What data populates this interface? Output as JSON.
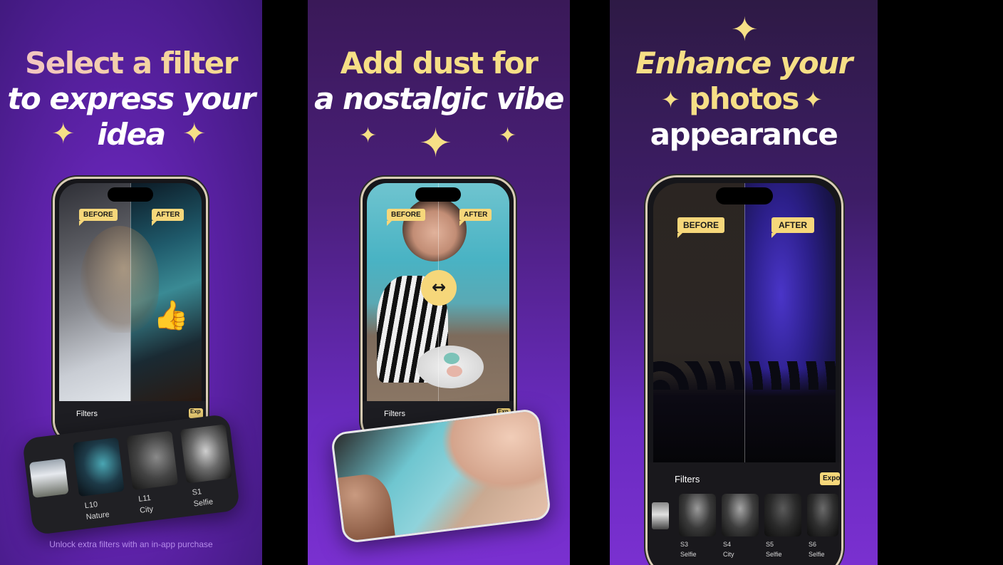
{
  "panel1": {
    "headline": [
      "Select a filter",
      "to express your",
      "idea"
    ],
    "tag_before": "BEFORE",
    "tag_after": "AFTER",
    "bar_label": "Filters",
    "bar_export": "Exp",
    "filters": [
      {
        "code": "",
        "name": ""
      },
      {
        "code": "L10",
        "name": "Nature"
      },
      {
        "code": "L11",
        "name": "City"
      },
      {
        "code": "S1",
        "name": "Selfie"
      }
    ],
    "caption": "Unlock extra filters with an in-app purchase",
    "thumb_icon": "thumbs-up"
  },
  "panel2": {
    "headline": [
      "Add dust for",
      "a nostalgic vibe"
    ],
    "tag_before": "BEFORE",
    "tag_after": "AFTER",
    "bar_label": "Filters",
    "bar_export": "Exp",
    "slider_icon": "↔"
  },
  "panel3": {
    "headline": [
      "Enhance your",
      "photos",
      "appearance"
    ],
    "tag_before": "BEFORE",
    "tag_after": "AFTER",
    "bar_label": "Filters",
    "bar_export": "Expo",
    "filters": [
      {
        "code": "S3",
        "name": "Selfie"
      },
      {
        "code": "S4",
        "name": "City"
      },
      {
        "code": "S5",
        "name": "Selfie"
      },
      {
        "code": "S6",
        "name": "Selfie"
      }
    ]
  },
  "colors": {
    "accent_yellow": "#f6df86",
    "tag_yellow": "#f6d77a",
    "purple": "#6a2bc0"
  }
}
